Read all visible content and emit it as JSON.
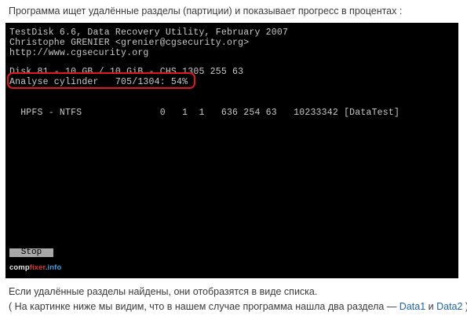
{
  "caption": "Программа ищет удалённые разделы (партиции) и показывает прогресс в процентах :",
  "terminal": {
    "lines": [
      "TestDisk 6.6, Data Recovery Utility, February 2007",
      "Christophe GRENIER <grenier@cgsecurity.org>",
      "http://www.cgsecurity.org",
      "Disk 81 - 10 GB / 10 GiB - CHS 1305 255 63",
      "Analyse cylinder   705/1304: 54%",
      "  HPFS - NTFS              0   1  1   636 254 63   10233342 [DataTest]"
    ],
    "progress_percent": 54,
    "stop_label": "Stop",
    "highlight_color": "#e01818"
  },
  "watermark": {
    "part1": "comp",
    "part2": "fixer",
    "part3": ".info"
  },
  "footer": {
    "line1": "Если удалённые разделы найдены, они отобразятся в виде списка.",
    "line2_prefix": "( На картинке ниже мы видим, что в нашем случае программа нашла два раздела — ",
    "link1": "Data1",
    "line2_mid": " и ",
    "link2": "Data2",
    "line2_suffix": " )"
  }
}
